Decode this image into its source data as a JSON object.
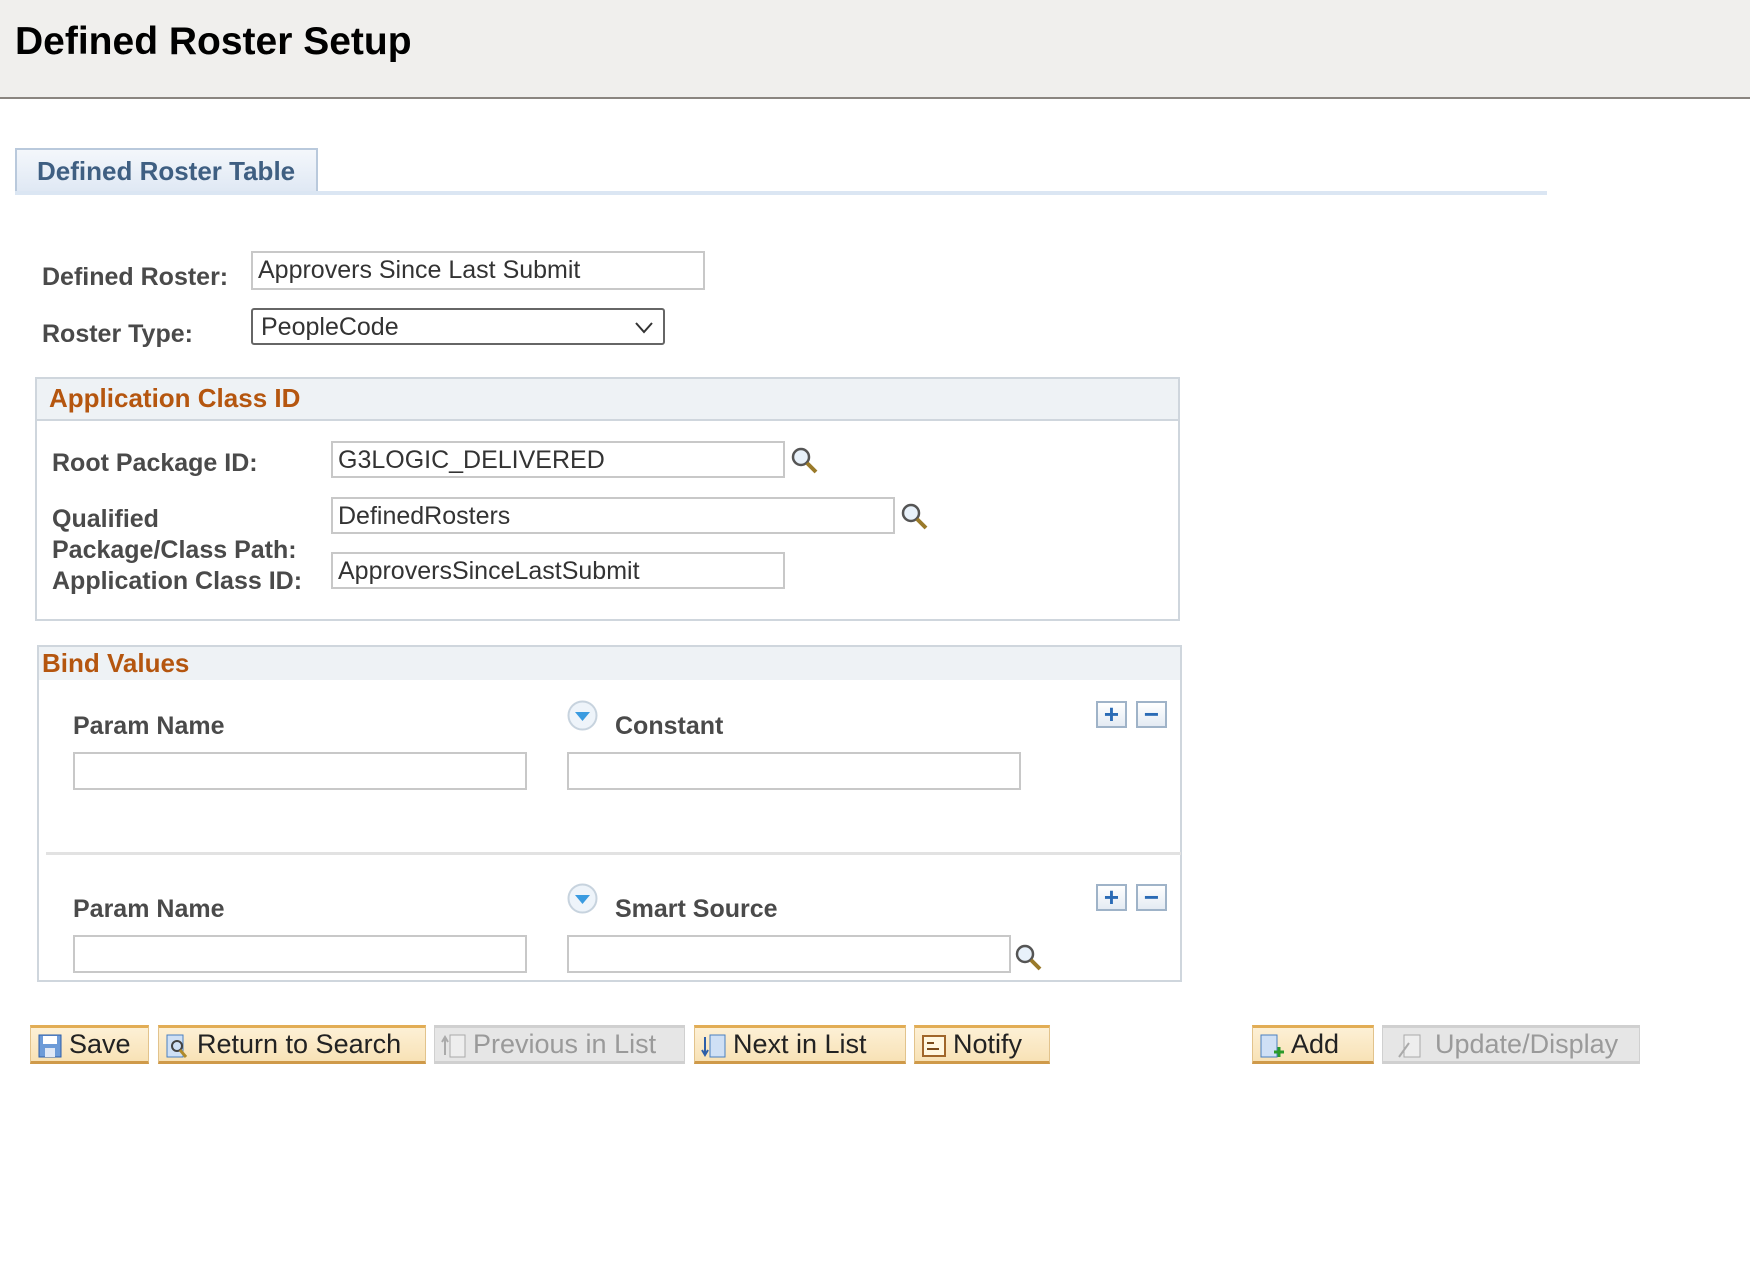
{
  "header": {
    "title": "Defined Roster Setup"
  },
  "tabs": [
    {
      "label": "Defined Roster Table",
      "active": true
    }
  ],
  "form": {
    "defined_roster": {
      "label": "Defined Roster:",
      "value": "Approvers Since Last Submit"
    },
    "roster_type": {
      "label": "Roster Type:",
      "value": "PeopleCode"
    }
  },
  "app_class": {
    "title": "Application Class ID",
    "root_package": {
      "label": "Root Package ID:",
      "value": "G3LOGIC_DELIVERED"
    },
    "qualified_path": {
      "label_line1": "Qualified",
      "label_line2": "Package/Class Path:",
      "value": "DefinedRosters"
    },
    "app_class_id": {
      "label": "Application Class ID:",
      "value": "ApproversSinceLastSubmit"
    }
  },
  "bind_values": {
    "title": "Bind Values",
    "rows": [
      {
        "param_label": "Param Name",
        "param_value": "",
        "source_label": "Constant",
        "source_value": ""
      },
      {
        "param_label": "Param Name",
        "param_value": "",
        "source_label": "Smart Source",
        "source_value": ""
      }
    ]
  },
  "toolbar": {
    "save": "Save",
    "return_to_search": "Return to Search",
    "previous_in_list": "Previous in List",
    "next_in_list": "Next in List",
    "notify": "Notify",
    "add": "Add",
    "update_display": "Update/Display"
  },
  "colors": {
    "section_title": "#b5560f",
    "tab_text": "#3f5f82",
    "button_bg": "#fdf0d5",
    "button_border": "#e2ad55",
    "disabled_bg": "#e6e6e6"
  }
}
